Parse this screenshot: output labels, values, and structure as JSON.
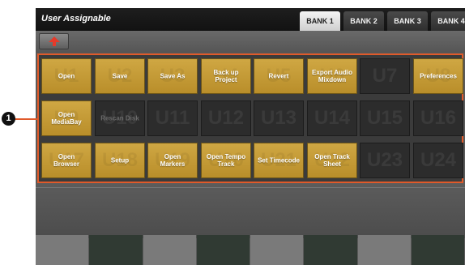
{
  "header": {
    "title": "User Assignable",
    "tabs": [
      {
        "label": "BANK 1",
        "active": true
      },
      {
        "label": "BANK 2",
        "active": false
      },
      {
        "label": "BANK 3",
        "active": false
      },
      {
        "label": "BANK 4",
        "active": false
      }
    ]
  },
  "toolbar": {
    "back_icon": "up-arrow-icon",
    "accent": "#e63a2a"
  },
  "buttons": [
    {
      "id": "U1",
      "label": "Open",
      "state": "on"
    },
    {
      "id": "U2",
      "label": "Save",
      "state": "on"
    },
    {
      "id": "U3",
      "label": "Save As",
      "state": "on"
    },
    {
      "id": "U4",
      "label": "Back up\nProject",
      "state": "on"
    },
    {
      "id": "U5",
      "label": "Revert",
      "state": "on"
    },
    {
      "id": "U6",
      "label": "Export Audio\nMixdown",
      "state": "on"
    },
    {
      "id": "U7",
      "label": "",
      "state": "off"
    },
    {
      "id": "U8",
      "label": "Preferences",
      "state": "on"
    },
    {
      "id": "U9",
      "label": "Open\nMediaBay",
      "state": "on"
    },
    {
      "id": "U10",
      "label": "Rescan Disk",
      "state": "dim"
    },
    {
      "id": "U11",
      "label": "",
      "state": "off"
    },
    {
      "id": "U12",
      "label": "",
      "state": "off"
    },
    {
      "id": "U13",
      "label": "",
      "state": "off"
    },
    {
      "id": "U14",
      "label": "",
      "state": "off"
    },
    {
      "id": "U15",
      "label": "",
      "state": "off"
    },
    {
      "id": "U16",
      "label": "",
      "state": "off"
    },
    {
      "id": "U17",
      "label": "Open\nBrowser",
      "state": "on"
    },
    {
      "id": "U18",
      "label": "Setup",
      "state": "on"
    },
    {
      "id": "U19",
      "label": "Open\nMarkers",
      "state": "on"
    },
    {
      "id": "U20",
      "label": "Open Tempo\nTrack",
      "state": "on"
    },
    {
      "id": "U21",
      "label": "Set Timecode",
      "state": "on"
    },
    {
      "id": "U22",
      "label": "Open Track\nSheet",
      "state": "on"
    },
    {
      "id": "U23",
      "label": "",
      "state": "off"
    },
    {
      "id": "U24",
      "label": "",
      "state": "off"
    }
  ],
  "callout": {
    "number": "1"
  },
  "colors": {
    "button_on": "#c49c37",
    "button_off": "#2c2c2c",
    "highlight": "#e05a2a"
  }
}
